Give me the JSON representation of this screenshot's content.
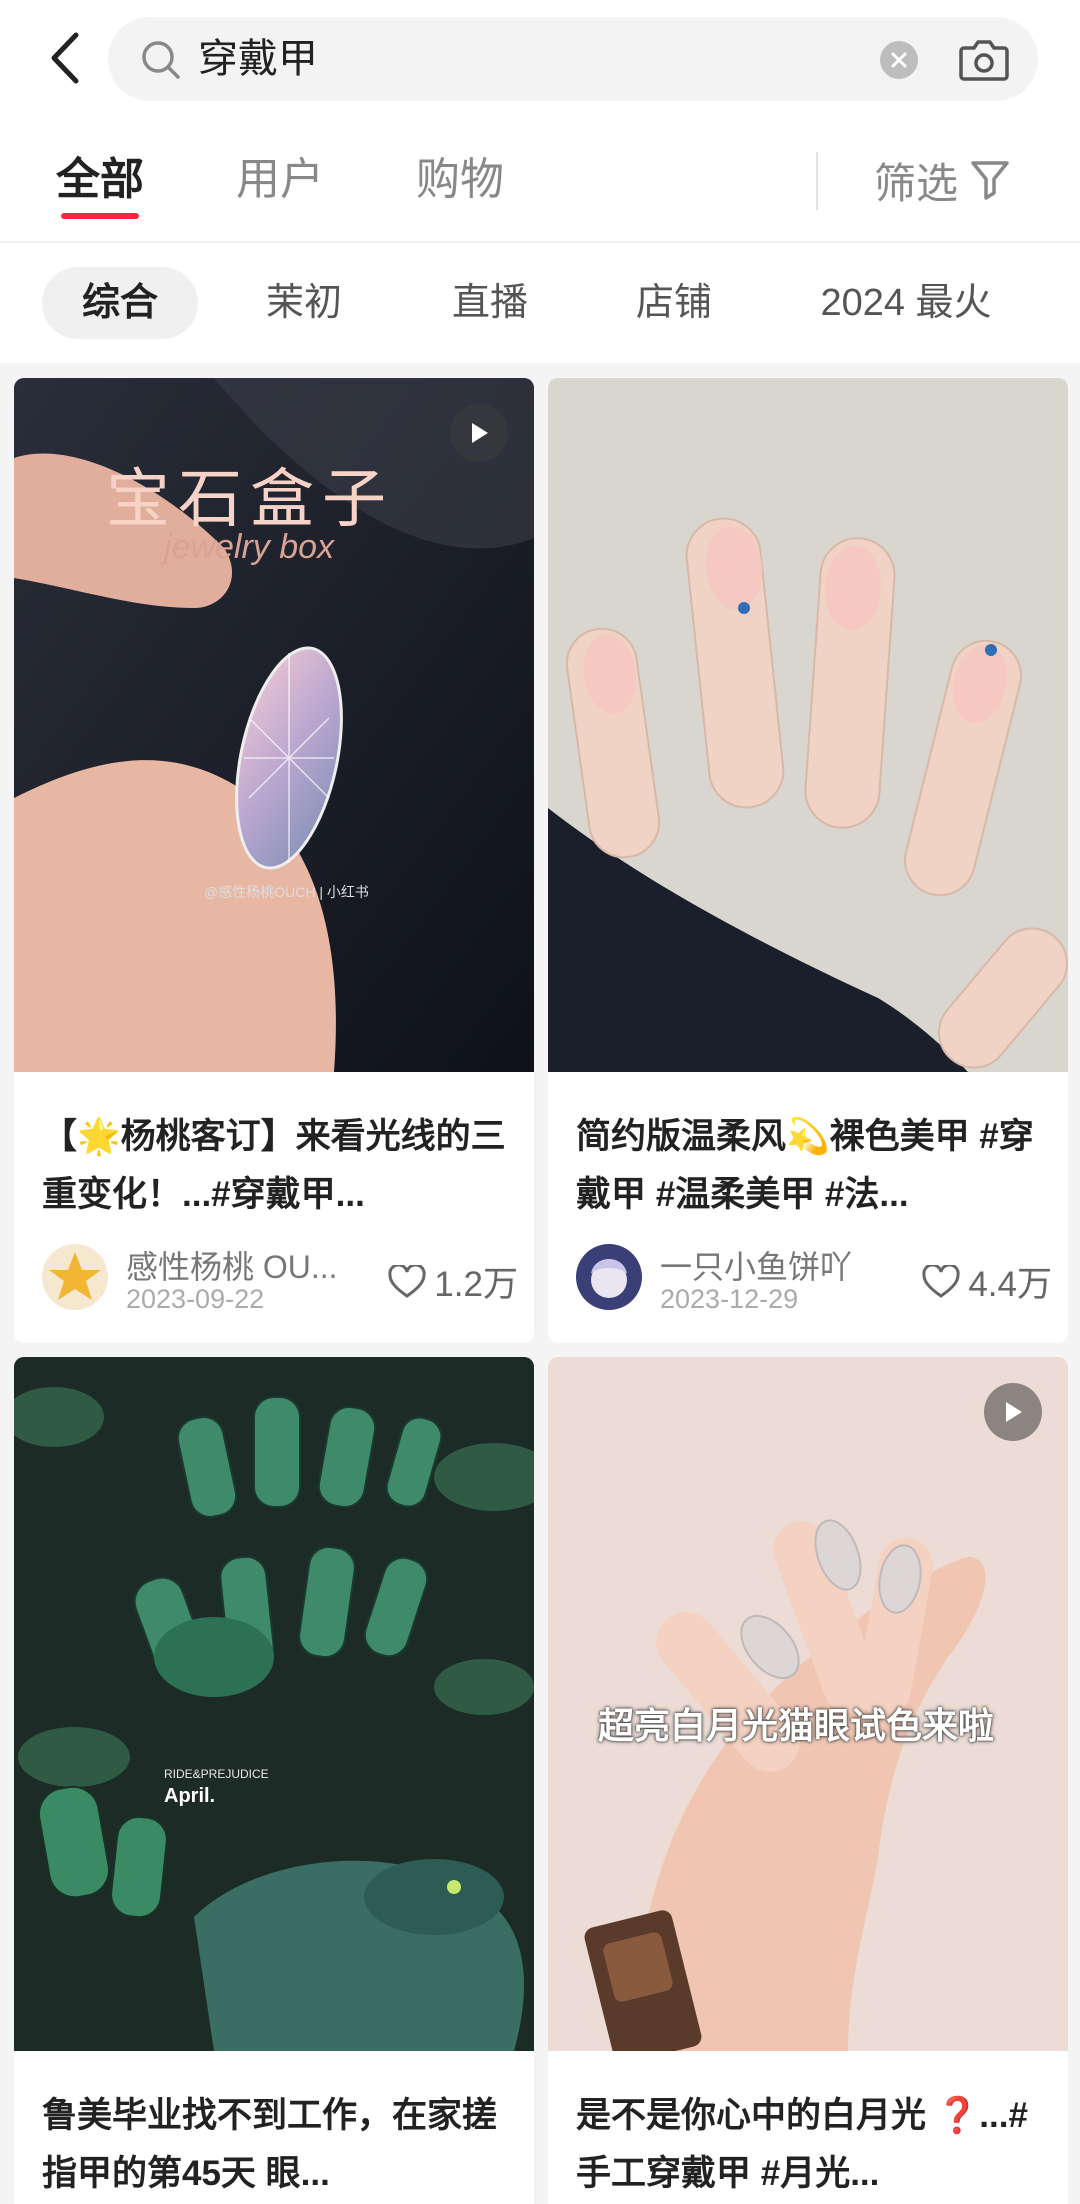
{
  "search": {
    "query": "穿戴甲"
  },
  "main_tabs": [
    {
      "label": "全部"
    },
    {
      "label": "用户"
    },
    {
      "label": "购物"
    }
  ],
  "filter": {
    "label": "筛选"
  },
  "sub_tabs": [
    {
      "label": "综合"
    },
    {
      "label": "茉初"
    },
    {
      "label": "直播"
    },
    {
      "label": "店铺"
    },
    {
      "label": "2024 最火"
    }
  ],
  "cards": [
    {
      "title": "【🌟杨桃客订】来看光线的三重变化！...#穿戴甲...",
      "image_title": "宝石盒子",
      "image_subtitle": "jewelry box",
      "image_watermark": "@感性杨桃OUCH | 小红书",
      "author": "感性杨桃 OU...",
      "date": "2023-09-22",
      "likes": "1.2万",
      "is_video": true
    },
    {
      "title": "简约版温柔风💫裸色美甲 #穿戴甲 #温柔美甲 #法...",
      "author": "一只小鱼饼吖",
      "date": "2023-12-29",
      "likes": "4.4万",
      "is_video": false
    },
    {
      "title": "鲁美毕业找不到工作，在家搓指甲的第45天 眼...",
      "image_brand": "RIDE&PREJUDICE",
      "image_month": "April.",
      "is_video": false
    },
    {
      "title": "是不是你心中的白月光 ❓...#手工穿戴甲 #月光...",
      "image_caption": "超亮白月光猫眼试色来啦",
      "is_video": true
    }
  ],
  "colors": {
    "accent": "#ff2442",
    "background": "#f4f4f4"
  }
}
